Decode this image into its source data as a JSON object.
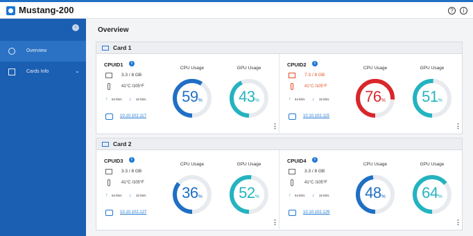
{
  "header": {
    "title": "Mustang-200",
    "help_icon": "help-icon",
    "about_icon": "info-icon",
    "help_glyph": "?",
    "about_glyph": "i"
  },
  "sidebar": {
    "collapse_glyph": "‹",
    "items": [
      {
        "label": "Overview",
        "icon": "gauge-icon",
        "active": true
      },
      {
        "label": "Cards Info",
        "icon": "card-icon",
        "active": false,
        "chevron": "⌄"
      }
    ]
  },
  "main": {
    "title": "Overview",
    "cards": [
      {
        "title": "Card 1",
        "cpus": [
          {
            "id": "CPUID1",
            "memory": "3.3 / 8 GB",
            "temperature": "41°C /105°F",
            "upload": "64 kb/s",
            "download": "32 kb/s",
            "ip": "10.10.102.117",
            "cpu_usage_label": "CPU Usage",
            "gpu_usage_label": "GPU Usage",
            "cpu_usage": 59,
            "gpu_usage": 43,
            "cpu_color": "#1f6fc4",
            "gpu_color": "#24b3c0",
            "memory_warning": false,
            "temp_warning": false
          },
          {
            "id": "CPUID2",
            "memory": "7.3 / 8 GB",
            "temperature": "41°C /105°F",
            "upload": "64 kb/s",
            "download": "32 kb/s",
            "ip": "10.10.102.115",
            "cpu_usage_label": "CPU Usage",
            "gpu_usage_label": "GPU Usage",
            "cpu_usage": 76,
            "gpu_usage": 51,
            "cpu_color": "#d9262b",
            "gpu_color": "#24b3c0",
            "memory_warning": true,
            "temp_warning": true
          }
        ]
      },
      {
        "title": "Card 2",
        "cpus": [
          {
            "id": "CPUID3",
            "memory": "3.3 / 8 GB",
            "temperature": "41°C /105°F",
            "upload": "64 kb/s",
            "download": "32 kb/s",
            "ip": "10.10.102.127",
            "cpu_usage_label": "CPU Usage",
            "gpu_usage_label": "GPU Usage",
            "cpu_usage": 36,
            "gpu_usage": 52,
            "cpu_color": "#1f6fc4",
            "gpu_color": "#24b3c0",
            "memory_warning": false,
            "temp_warning": false
          },
          {
            "id": "CPUID4",
            "memory": "3.3 / 8 GB",
            "temperature": "41°C /105°F",
            "upload": "64 kb/s",
            "download": "32 kb/s",
            "ip": "10.10.102.129",
            "cpu_usage_label": "CPU Usage",
            "gpu_usage_label": "GPU Usage",
            "cpu_usage": 48,
            "gpu_usage": 64,
            "cpu_color": "#1f6fc4",
            "gpu_color": "#24b3c0",
            "memory_warning": false,
            "temp_warning": false
          }
        ]
      }
    ]
  },
  "symbols": {
    "info": "i",
    "up_arrow": "↑",
    "down_arrow": "↓",
    "percent": "%",
    "kebab": "⋮"
  },
  "colors": {
    "sidebar": "#1b5fb3",
    "accent": "#1d76d2",
    "warning": "#e24a1e",
    "gauge_track": "#e7eaee"
  }
}
